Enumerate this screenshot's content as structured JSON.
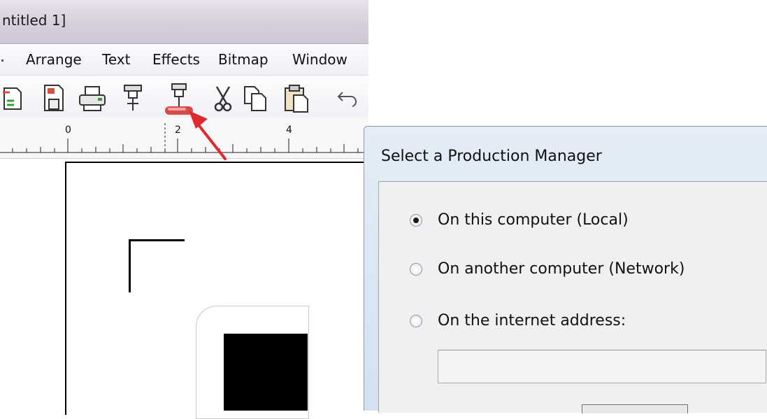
{
  "app": {
    "title_fragment": "ntitled 1]",
    "menu": [
      "Arrange",
      "Text",
      "Effects",
      "Bitmap",
      "Window"
    ],
    "toolbar_icons": [
      "export-icon",
      "save-icon",
      "print-icon",
      "cut-plotter-icon",
      "production-manager-icon",
      "scissors-icon",
      "copy-icon",
      "paste-icon",
      "undo-icon"
    ],
    "ruler_numbers": [
      "0",
      "2",
      "4"
    ]
  },
  "annotation": {
    "arrow_color": "#e0282e"
  },
  "dialog": {
    "title": "Select a Production Manager",
    "options": [
      {
        "label": "On this computer (Local)",
        "selected": true
      },
      {
        "label": "On another computer (Network)",
        "selected": false
      },
      {
        "label": "On the internet address:",
        "selected": false
      }
    ],
    "address_value": ""
  }
}
